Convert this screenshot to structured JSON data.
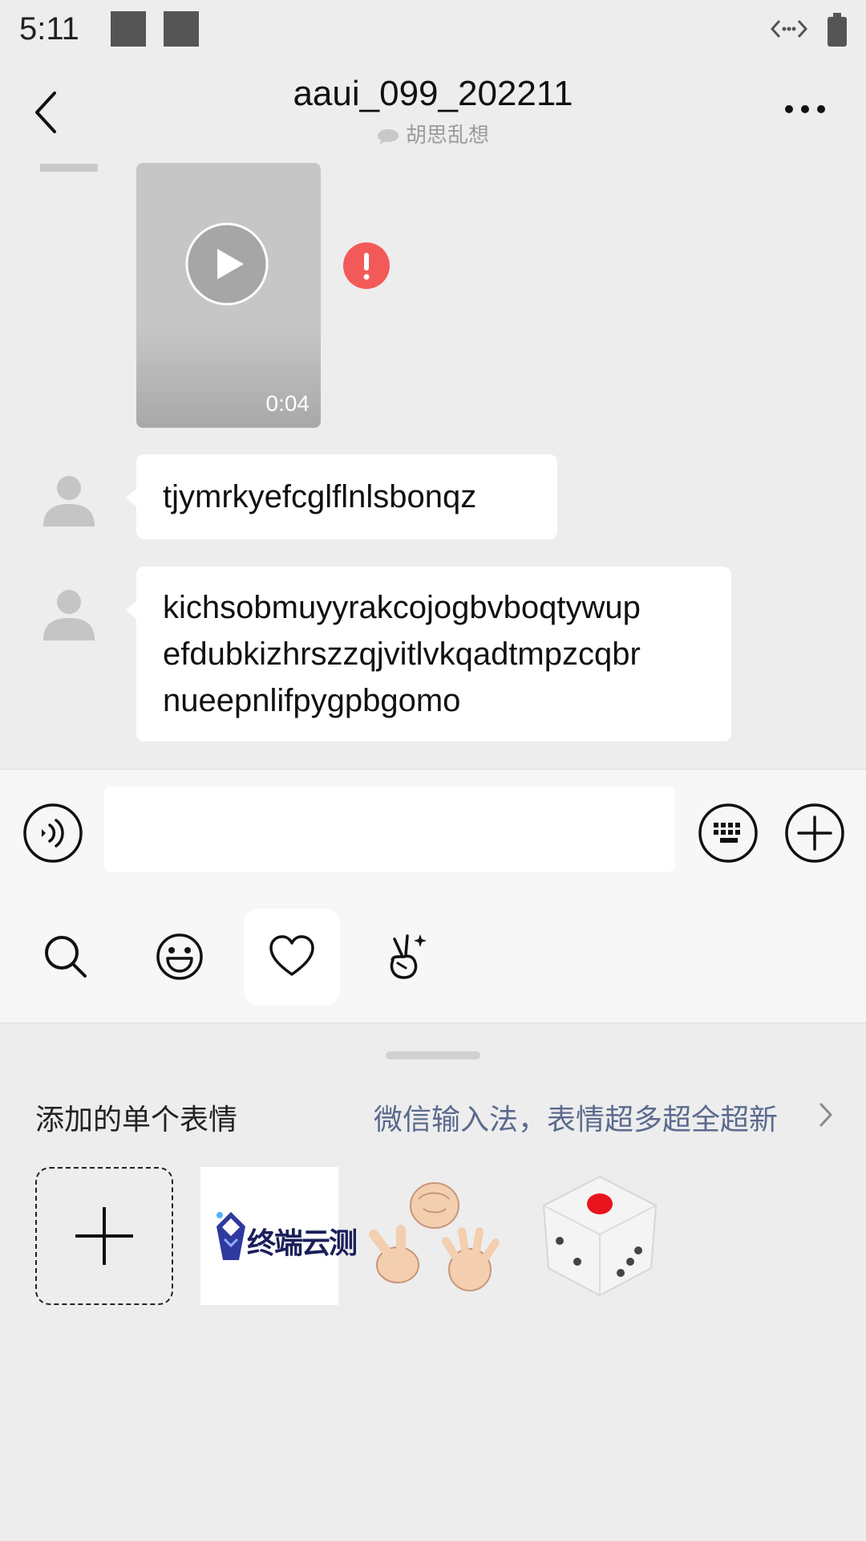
{
  "status_bar": {
    "time": "5:11"
  },
  "header": {
    "title": "aaui_099_202211",
    "subtitle": "胡思乱想"
  },
  "messages": {
    "video": {
      "duration": "0:04"
    },
    "text_1": "tjymrkyefcglflnlsbonqz",
    "text_2_lines": [
      "kichsobmuyyrakcojogbvboqtywup",
      "efdubkizhrszzqjvitlvkqadtmpzcqbr",
      "nueepnlifpygpbgomo"
    ]
  },
  "input": {
    "value": ""
  },
  "emoji_panel": {
    "tabs": [
      "search-icon",
      "smiley-icon",
      "heart-icon",
      "peace-hand-icon"
    ],
    "active_tab": "heart-icon",
    "section_title": "添加的单个表情",
    "promo_link": "微信输入法，表情超多超全超新",
    "stickers": [
      {
        "kind": "add"
      },
      {
        "kind": "logo",
        "text": "终端云测"
      },
      {
        "kind": "rock-paper-scissors"
      },
      {
        "kind": "dice"
      }
    ]
  },
  "colors": {
    "error": "#f25a5a",
    "link": "#5b6a8e",
    "background": "#ededed"
  }
}
